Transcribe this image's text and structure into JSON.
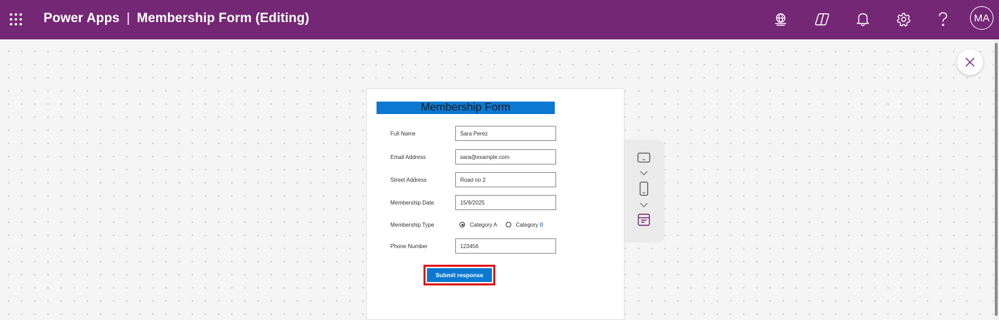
{
  "header": {
    "app_name": "Power Apps",
    "separator": "|",
    "document_title": "Membership Form (Editing)",
    "icons": [
      "app-launcher-icon",
      "environment-globe-icon",
      "copilot-icon",
      "notifications-bell-icon",
      "settings-gear-icon",
      "help-question-icon"
    ],
    "avatar_initials": "MA",
    "background_color": "#742774"
  },
  "canvas": {
    "close_icon": "close-icon"
  },
  "device_toolbar": {
    "icons": [
      "tablet-icon",
      "chevron-down-icon",
      "phone-icon",
      "chevron-down-icon",
      "web-layout-icon"
    ]
  },
  "form": {
    "title": "Membership Form",
    "title_bar_color": "#0c78d2",
    "fields": [
      {
        "label": "Full Name",
        "value": "Sara Perez"
      },
      {
        "label": "Email Address",
        "value": "sara@example.com"
      },
      {
        "label": "Street Address",
        "value": "Road no 2"
      },
      {
        "label": "Membership Date",
        "value": "15/9/2025"
      }
    ],
    "membership_type": {
      "label": "Membership Type",
      "options": [
        {
          "label_main": "Category A",
          "label_suffix": "",
          "selected": true
        },
        {
          "label_main": "Category ",
          "label_suffix": "B",
          "selected": false
        }
      ]
    },
    "phone": {
      "label": "Phone Number",
      "value": "123456"
    },
    "submit_label": "Submit response",
    "highlight_color": "#e0161b"
  }
}
